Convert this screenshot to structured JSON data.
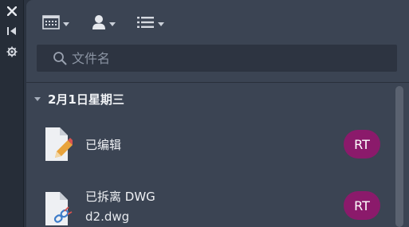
{
  "left_strip": {
    "icons": [
      "close-icon",
      "pin-icon",
      "settings-icon"
    ]
  },
  "toolbar": {
    "buttons": [
      "calendar-view-icon",
      "user-filter-icon",
      "list-view-icon"
    ]
  },
  "search": {
    "placeholder": "文件名",
    "value": ""
  },
  "group": {
    "title": "2月1日星期三"
  },
  "items": [
    {
      "title": "已编辑",
      "subtitle": "",
      "avatar": "RT",
      "icon": "edited-document-icon"
    },
    {
      "title": "已拆离 DWG",
      "subtitle": "d2.dwg",
      "avatar": "RT",
      "icon": "detached-dwg-icon"
    }
  ],
  "colors": {
    "background": "#2b3340",
    "panel": "#3b4453",
    "search_bg": "#2d3441",
    "avatar": "#8b1a6b",
    "text": "#f0f2f5"
  }
}
